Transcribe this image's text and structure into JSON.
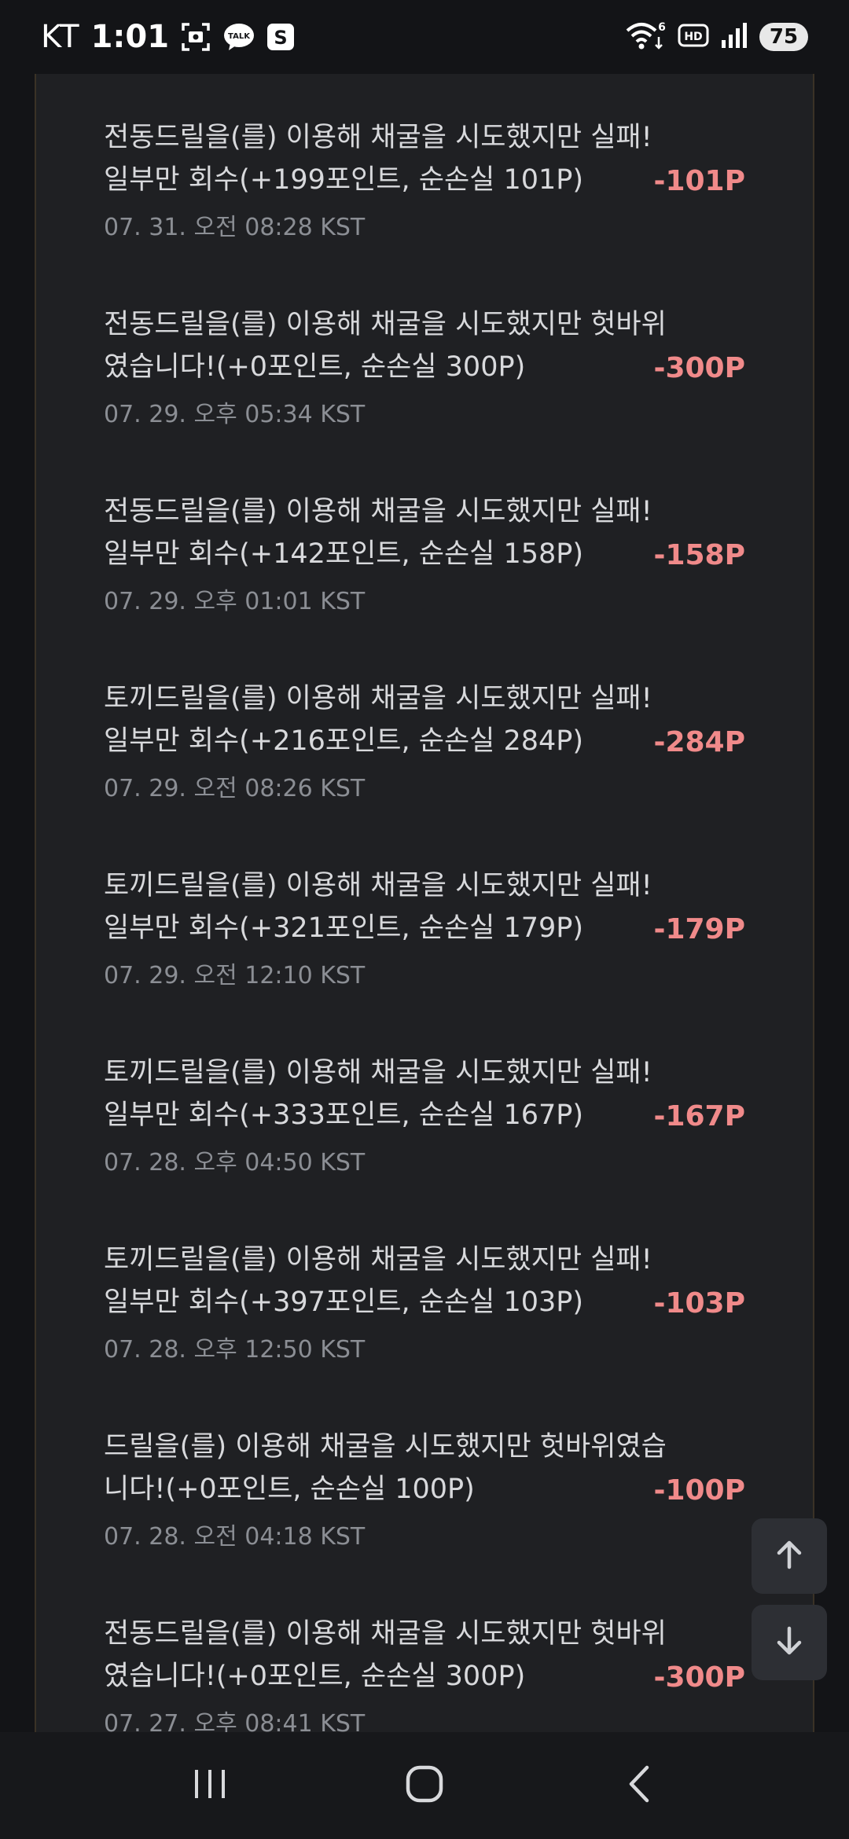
{
  "status_bar": {
    "carrier": "KT",
    "time": "1:01",
    "talk_badge": "TALK",
    "s_badge": "S",
    "wifi_badge": "6",
    "hd_badge": "HD",
    "battery": "75"
  },
  "items": [
    {
      "text": "전동드릴을(를) 이용해 채굴을 시도했지만 실패! 일부만 회수(+199포인트, 순손실 101P)",
      "date": "07. 31. 오전 08:28 KST",
      "amount": "-101P"
    },
    {
      "text": "전동드릴을(를) 이용해 채굴을 시도했지만 헛바위였습니다!(+0포인트, 순손실 300P)",
      "date": "07. 29. 오후 05:34 KST",
      "amount": "-300P"
    },
    {
      "text": "전동드릴을(를) 이용해 채굴을 시도했지만 실패! 일부만 회수(+142포인트, 순손실 158P)",
      "date": "07. 29. 오후 01:01 KST",
      "amount": "-158P"
    },
    {
      "text": "토끼드릴을(를) 이용해 채굴을 시도했지만 실패! 일부만 회수(+216포인트, 순손실 284P)",
      "date": "07. 29. 오전 08:26 KST",
      "amount": "-284P"
    },
    {
      "text": "토끼드릴을(를) 이용해 채굴을 시도했지만 실패! 일부만 회수(+321포인트, 순손실 179P)",
      "date": "07. 29. 오전 12:10 KST",
      "amount": "-179P"
    },
    {
      "text": "토끼드릴을(를) 이용해 채굴을 시도했지만 실패! 일부만 회수(+333포인트, 순손실 167P)",
      "date": "07. 28. 오후 04:50 KST",
      "amount": "-167P"
    },
    {
      "text": "토끼드릴을(를) 이용해 채굴을 시도했지만 실패! 일부만 회수(+397포인트, 순손실 103P)",
      "date": "07. 28. 오후 12:50 KST",
      "amount": "-103P"
    },
    {
      "text": "드릴을(를) 이용해 채굴을 시도했지만 헛바위였습니다!(+0포인트, 순손실 100P)",
      "date": "07. 28. 오전 04:18 KST",
      "amount": "-100P"
    },
    {
      "text": "전동드릴을(를) 이용해 채굴을 시도했지만 헛바위였습니다!(+0포인트, 순손실 300P)",
      "date": "07. 27. 오후 08:41 KST",
      "amount": "-300P"
    }
  ],
  "colors": {
    "background": "#131417",
    "card": "#1f2023",
    "text": "#d8d9dc",
    "date": "#8b8e94",
    "amount_negative": "#f08a8a"
  },
  "icons": {
    "scroll_up": "arrow-up-icon",
    "scroll_down": "arrow-down-icon",
    "nav_recents": "recents-icon",
    "nav_home": "home-icon",
    "nav_back": "back-icon"
  }
}
